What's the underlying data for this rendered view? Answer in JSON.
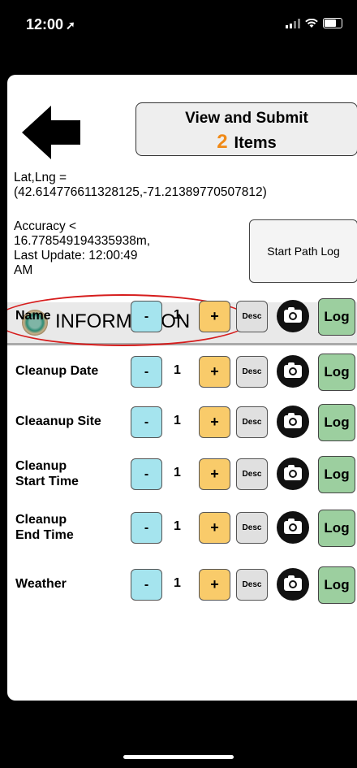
{
  "status_bar": {
    "time": "12:00"
  },
  "header": {
    "view_submit_title": "View and Submit",
    "item_count": "2",
    "items_label": "Items"
  },
  "location": {
    "latlng_label": "Lat,Lng =",
    "latlng_value": "(42.614776611328125,-71.21389770507812)",
    "accuracy_line1": "Accuracy <",
    "accuracy_line2": "16.778549194335938m,",
    "accuracy_line3": "Last Update: 12:00:49",
    "accuracy_line4": "AM",
    "start_path_log_label": "Start Path Log"
  },
  "section": {
    "title": "INFORMATION"
  },
  "fields": [
    {
      "label_line1": "Name",
      "label_line2": "",
      "qty": "1"
    },
    {
      "label_line1": "Cleanup Date",
      "label_line2": "",
      "qty": "1"
    },
    {
      "label_line1": "Cleaanup Site",
      "label_line2": "",
      "qty": "1"
    },
    {
      "label_line1": "Cleanup",
      "label_line2": "Start Time",
      "qty": "1"
    },
    {
      "label_line1": "Cleanup",
      "label_line2": "End Time",
      "qty": "1"
    },
    {
      "label_line1": "Weather",
      "label_line2": "",
      "qty": "1"
    }
  ],
  "buttons": {
    "minus": "-",
    "plus": "+",
    "desc": "Desc",
    "log": "Log"
  },
  "colors": {
    "count_accent": "#f08a17",
    "minus_bg": "#a5e4ee",
    "plus_bg": "#f9cb6a",
    "log_bg": "#9ccf9f",
    "annotation_red": "#d61d1d"
  }
}
